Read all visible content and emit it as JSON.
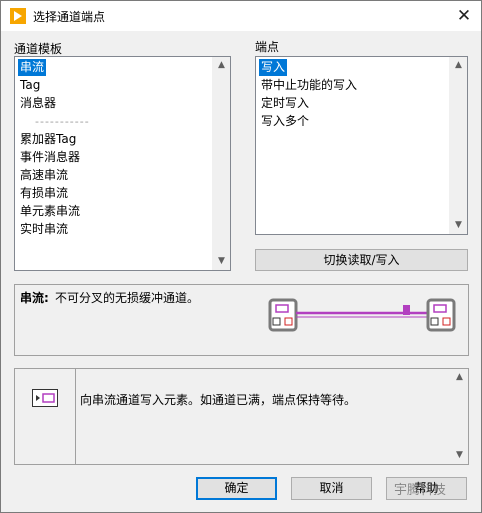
{
  "window": {
    "title": "选择通道端点",
    "close_glyph": "✕"
  },
  "templates": {
    "label": "通道模板",
    "items": [
      "串流",
      "Tag",
      "消息器"
    ],
    "separator": "-----------",
    "items2": [
      "累加器Tag",
      "事件消息器",
      "高速串流",
      "有损串流",
      "单元素串流",
      "实时串流"
    ],
    "selected": "串流"
  },
  "endpoints": {
    "label": "端点",
    "items": [
      "写入",
      "带中止功能的写入",
      "定时写入",
      "写入多个"
    ],
    "selected": "写入"
  },
  "toggle_button": "切换读取/写入",
  "description": {
    "title": "串流:",
    "text": "不可分叉的无损缓冲通道。"
  },
  "node_help": {
    "text": "向串流通道写入元素。如通道已满，端点保持等待。"
  },
  "buttons": {
    "ok": "确定",
    "cancel": "取消",
    "help": "帮助"
  },
  "watermark": "宇腾科技",
  "colors": {
    "accent": "#0078d7",
    "channel_wire": "#b23fc0",
    "write_indicator": "#d02020"
  },
  "icons": {
    "app": "labview-run-arrow-icon",
    "close": "close-icon",
    "scroll_up": "chevron-up-icon",
    "scroll_down": "chevron-down-icon"
  }
}
